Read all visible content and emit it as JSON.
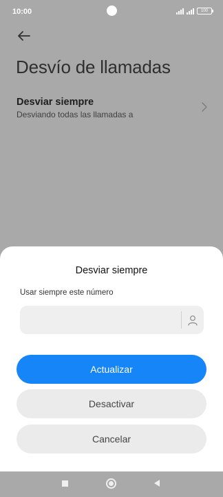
{
  "statusbar": {
    "time": "10:00",
    "battery": "100"
  },
  "page": {
    "title": "Desvío de llamadas"
  },
  "setting_item": {
    "title": "Desviar siempre",
    "subtitle": "Desviando todas las llamadas a"
  },
  "dialog": {
    "title": "Desviar siempre",
    "field_label": "Usar siempre este número",
    "number_value": "",
    "primary_button": "Actualizar",
    "deactivate_button": "Desactivar",
    "cancel_button": "Cancelar"
  },
  "colors": {
    "accent": "#1585f8",
    "overlay": "#a9a9a9",
    "input_bg": "#efefef",
    "secondary_button_bg": "#ebebeb"
  },
  "icons": {
    "back": "arrow-left-icon",
    "chevron": "chevron-right-icon",
    "contact": "person-icon",
    "nav_recents": "square-icon",
    "nav_home": "circle-icon",
    "nav_back": "triangle-left-icon"
  }
}
